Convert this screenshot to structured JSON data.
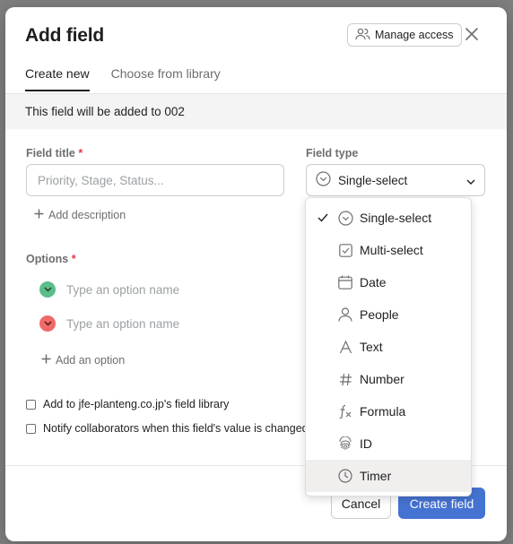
{
  "modal": {
    "title": "Add field",
    "manage_access_label": "Manage access",
    "tabs": [
      {
        "label": "Create new",
        "active": true
      },
      {
        "label": "Choose from library",
        "active": false
      }
    ],
    "banner_text": "This field will be added to 002"
  },
  "form": {
    "field_title_label": "Field title",
    "required_marker": "*",
    "field_title_placeholder": "Priority, Stage, Status...",
    "field_title_value": "",
    "add_description_label": "Add description",
    "field_type_label": "Field type",
    "field_type_value": "Single-select",
    "options_label": "Options",
    "options": [
      {
        "placeholder": "Type an option name",
        "color": "#5dbd8a"
      },
      {
        "placeholder": "Type an option name",
        "color": "#f06a6a"
      }
    ],
    "add_option_label": "Add an option",
    "checkboxes": [
      {
        "label": "Add to jfe-planteng.co.jp's field library",
        "checked": false
      },
      {
        "label": "Notify collaborators when this field's value is changed",
        "checked": false
      }
    ]
  },
  "footer": {
    "cancel_label": "Cancel",
    "create_label": "Create field",
    "accent_color": "#4573d2"
  },
  "dropdown": {
    "items": [
      {
        "label": "Single-select",
        "icon": "single-select-icon",
        "selected": true
      },
      {
        "label": "Multi-select",
        "icon": "multi-select-icon",
        "selected": false
      },
      {
        "label": "Date",
        "icon": "calendar-icon",
        "selected": false
      },
      {
        "label": "People",
        "icon": "person-icon",
        "selected": false
      },
      {
        "label": "Text",
        "icon": "text-icon",
        "selected": false
      },
      {
        "label": "Number",
        "icon": "hash-icon",
        "selected": false
      },
      {
        "label": "Formula",
        "icon": "formula-icon",
        "selected": false
      },
      {
        "label": "ID",
        "icon": "fingerprint-icon",
        "selected": false
      },
      {
        "label": "Timer",
        "icon": "clock-icon",
        "selected": false,
        "hovered": true
      }
    ]
  }
}
